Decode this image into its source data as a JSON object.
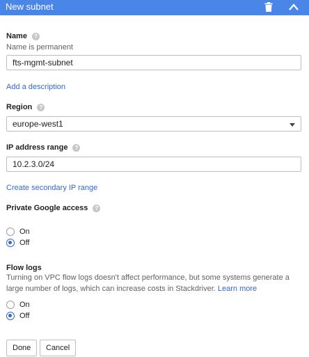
{
  "header": {
    "title": "New subnet",
    "trash_icon": "trash-icon",
    "collapse_icon": "chevron-up-icon",
    "background": "#4a86e8"
  },
  "name": {
    "label": "Name",
    "hint": "Name is permanent",
    "value": "fts-mgmt-subnet",
    "help_icon": "help-icon"
  },
  "add_description_link": "Add a description",
  "region": {
    "label": "Region",
    "value": "europe-west1",
    "help_icon": "help-icon"
  },
  "ip_range": {
    "label": "IP address range",
    "value": "10.2.3.0/24",
    "help_icon": "help-icon"
  },
  "secondary_range_link": "Create secondary IP range",
  "private_google_access": {
    "label": "Private Google access",
    "options": [
      {
        "label": "On",
        "checked": false
      },
      {
        "label": "Off",
        "checked": true
      }
    ]
  },
  "flow_logs": {
    "label": "Flow logs",
    "description": "Turning on VPC flow logs doesn't affect performance, but some systems generate a large number of logs, which can increase costs in Stackdriver.",
    "learn_more": "Learn more",
    "options": [
      {
        "label": "On",
        "checked": false
      },
      {
        "label": "Off",
        "checked": true
      }
    ]
  },
  "buttons": {
    "done": "Done",
    "cancel": "Cancel"
  },
  "accent_color": "#3367d6"
}
